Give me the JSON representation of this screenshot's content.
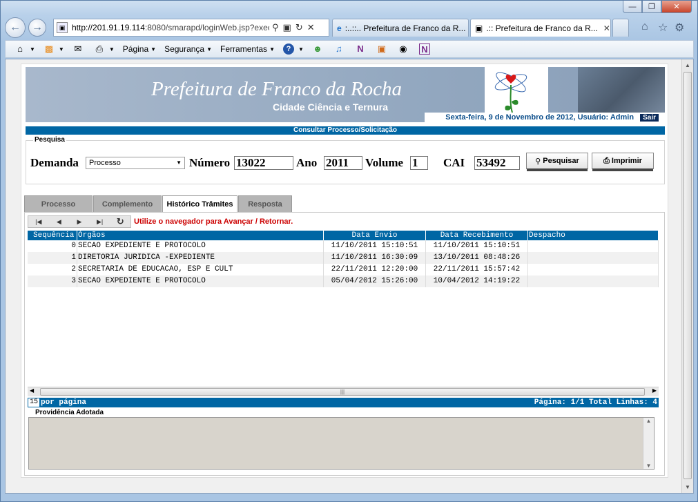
{
  "browser": {
    "address_host": "http://201.91.19.114",
    "address_rest": ":8080/smarapd/loginWeb.jsp?exec",
    "tabs": [
      {
        "label": ":..::.. Prefeitura de Franco da R..."
      },
      {
        "label": ".:: Prefeitura de Franco da R..."
      }
    ],
    "menu": {
      "pagina": "Página",
      "seguranca": "Segurança",
      "ferramentas": "Ferramentas"
    }
  },
  "header": {
    "title": "Prefeitura de Franco da Rocha",
    "subtitle": "Cidade Ciência e Ternura",
    "status": "Sexta-feira, 9 de Novembro de 2012, Usuário: Admin",
    "logout": "Sair"
  },
  "page_title": "Consultar Processo/Solicitação",
  "search": {
    "legend": "Pesquisa",
    "demanda_label": "Demanda",
    "demanda_value": "Processo",
    "numero_label": "Número",
    "numero_value": "13022",
    "ano_label": "Ano",
    "ano_value": "2011",
    "volume_label": "Volume",
    "volume_value": "1",
    "cai_label": "CAI",
    "cai_value": "53492",
    "search_button": "Pesquisar",
    "print_button": "Imprimir"
  },
  "tabs": [
    {
      "label": "Processo"
    },
    {
      "label": "Complemento"
    },
    {
      "label": "Histórico Trâmites"
    },
    {
      "label": "Resposta"
    }
  ],
  "nav_hint": "Utilize o navegador para Avançar / Retornar.",
  "table": {
    "columns": [
      "Sequência",
      "Órgãos",
      "Data Envio",
      "Data Recebimento",
      "Despacho"
    ],
    "rows": [
      {
        "seq": "0",
        "orgao": "SECAO EXPEDIENTE E PROTOCOLO",
        "envio": "11/10/2011 15:10:51",
        "recebimento": "11/10/2011 15:10:51",
        "despacho": ""
      },
      {
        "seq": "1",
        "orgao": "DIRETORIA JURIDICA -EXPEDIENTE",
        "envio": "11/10/2011 16:30:09",
        "recebimento": "13/10/2011 08:48:26",
        "despacho": ""
      },
      {
        "seq": "2",
        "orgao": "SECRETARIA DE EDUCACAO, ESP E CULT",
        "envio": "22/11/2011 12:20:00",
        "recebimento": "22/11/2011 15:57:42",
        "despacho": ""
      },
      {
        "seq": "3",
        "orgao": "SECAO EXPEDIENTE E PROTOCOLO",
        "envio": "05/04/2012 15:26:00",
        "recebimento": "10/04/2012 14:19:22",
        "despacho": ""
      }
    ]
  },
  "pager": {
    "per_page_value": "15",
    "per_page_label": "por página",
    "status": "Página: 1/1 Total Linhas: 4"
  },
  "providencia": {
    "label": "Providência Adotada"
  },
  "colors": {
    "accent_blue": "#0066a4",
    "hint_red": "#cc0000"
  }
}
